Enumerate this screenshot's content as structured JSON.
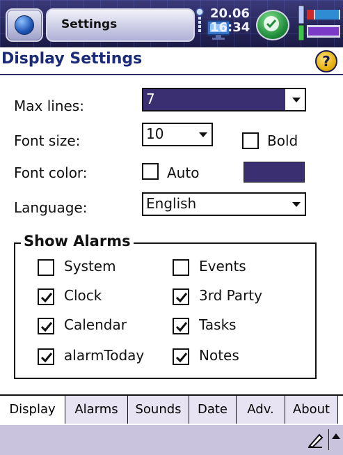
{
  "status_bar": {
    "app_title": "Settings",
    "time_line1": "20.06",
    "time_line2": "16:34",
    "icons": [
      "start-orb-icon",
      "monitor-icon",
      "clock-icon",
      "ok-icon",
      "battery-icon"
    ]
  },
  "header": {
    "title": "Display Settings",
    "help_glyph": "?"
  },
  "form": {
    "max_lines_label": "Max lines:",
    "max_lines_value": "7",
    "font_size_label": "Font size:",
    "font_size_value": "10",
    "bold_label": "Bold",
    "bold_checked": false,
    "font_color_label": "Font color:",
    "auto_label": "Auto",
    "auto_checked": false,
    "font_color_swatch": "#3a2f70",
    "language_label": "Language:",
    "language_value": "English"
  },
  "alarms": {
    "legend": "Show Alarms",
    "left": [
      {
        "label": "System",
        "checked": false
      },
      {
        "label": "Clock",
        "checked": true
      },
      {
        "label": "Calendar",
        "checked": true
      },
      {
        "label": "alarmToday",
        "checked": true
      }
    ],
    "right": [
      {
        "label": "Events",
        "checked": false
      },
      {
        "label": "3rd Party",
        "checked": true
      },
      {
        "label": "Tasks",
        "checked": true
      },
      {
        "label": "Notes",
        "checked": true
      }
    ]
  },
  "tabs": [
    {
      "label": "Display",
      "active": true
    },
    {
      "label": "Alarms",
      "active": false
    },
    {
      "label": "Sounds",
      "active": false
    },
    {
      "label": "Date",
      "active": false
    },
    {
      "label": "Adv.",
      "active": false
    },
    {
      "label": "About",
      "active": false
    }
  ],
  "colors": {
    "accent": "#1a2a78",
    "selection": "#3a2f70",
    "bottom_bar": "#c9c3de"
  }
}
